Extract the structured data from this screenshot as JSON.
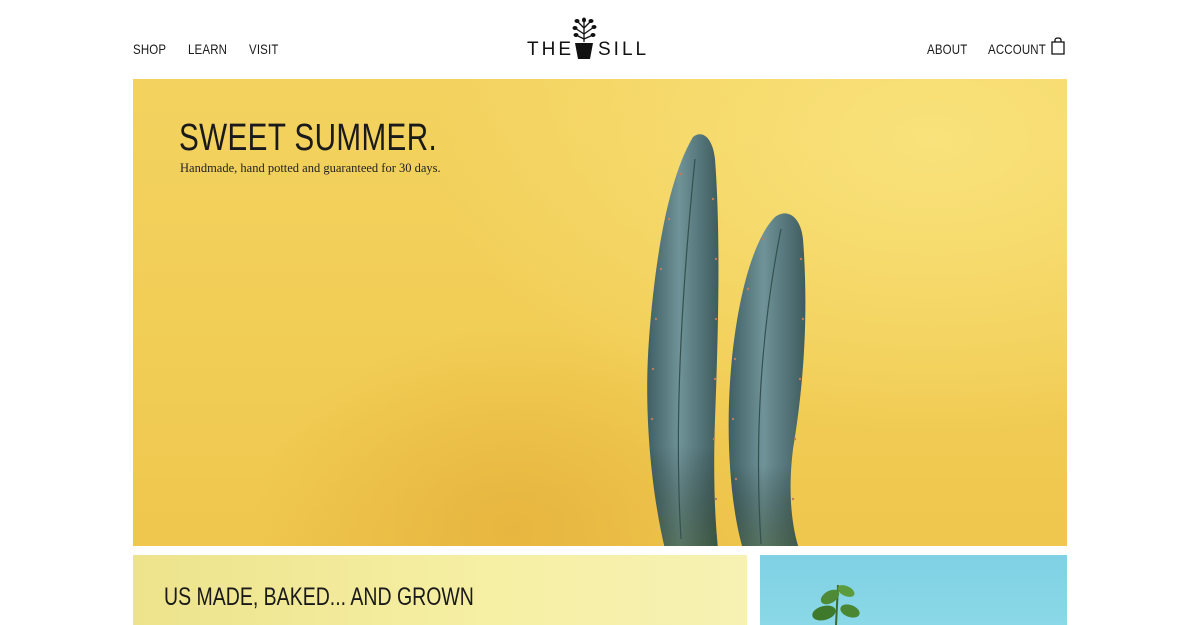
{
  "nav": {
    "left": [
      "SHOP",
      "LEARN",
      "VISIT"
    ],
    "right": [
      "ABOUT",
      "ACCOUNT"
    ]
  },
  "logo": {
    "left_text": "THE",
    "right_text": "SILL"
  },
  "icons": {
    "cart": "shopping-bag-icon",
    "logo_plant": "potted-plant-icon"
  },
  "hero": {
    "title": "SWEET SUMMER.",
    "subtitle": "Handmade, hand potted and guaranteed for 30 days."
  },
  "cards": {
    "left_title": "US MADE, BAKED... AND GROWN"
  },
  "colors": {
    "hero_yellow": "#f1cd55",
    "card_yellow": "#f6f0a5",
    "card_blue": "#84d4e5",
    "cactus": "#5b7f84"
  }
}
